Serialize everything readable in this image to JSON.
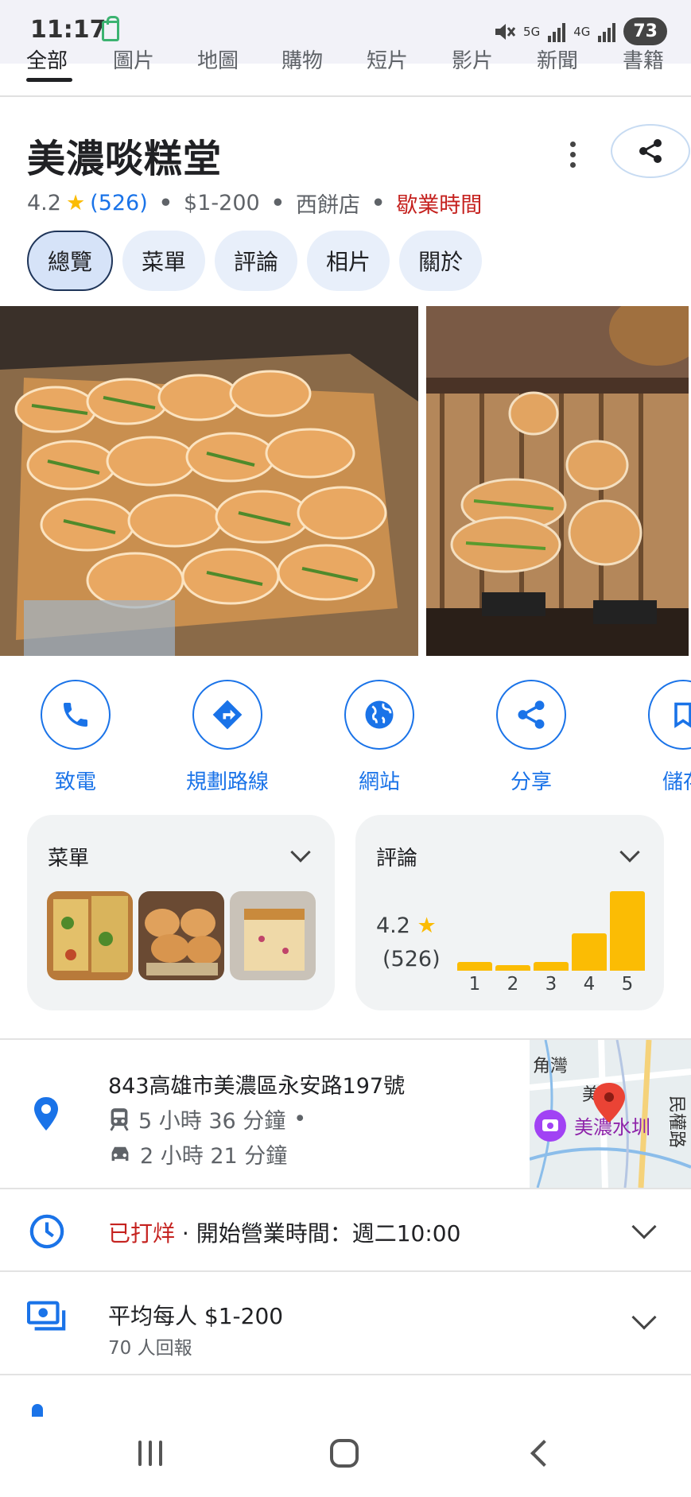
{
  "status_bar": {
    "time": "11:17",
    "network_5g": "5G",
    "network_4g": "4G",
    "battery": "73"
  },
  "search_tabs": [
    "全部",
    "圖片",
    "地圖",
    "購物",
    "短片",
    "影片",
    "新聞",
    "書籍"
  ],
  "place": {
    "name": "美濃啖糕堂",
    "rating": "4.2",
    "review_count": "(526)",
    "price": "$1-200",
    "category": "西餅店",
    "hours_status": "歇業時間"
  },
  "chips": [
    "總覽",
    "菜單",
    "評論",
    "相片",
    "關於"
  ],
  "actions": [
    {
      "label": "致電",
      "icon": "phone-icon"
    },
    {
      "label": "規劃路線",
      "icon": "directions-icon"
    },
    {
      "label": "網站",
      "icon": "globe-icon"
    },
    {
      "label": "分享",
      "icon": "share-icon"
    },
    {
      "label": "儲存",
      "icon": "bookmark-icon"
    }
  ],
  "menu_card": {
    "title": "菜單"
  },
  "reviews_card": {
    "title": "評論",
    "score": "4.2",
    "count": "(526)",
    "distribution_labels": [
      "1",
      "2",
      "3",
      "4",
      "5"
    ],
    "distribution_fraction": [
      0.08,
      0.05,
      0.08,
      0.34,
      0.72
    ]
  },
  "address": {
    "text": "843高雄市美濃區永安路197號",
    "transit": "5 小時 36 分鐘",
    "transit_sep": "•",
    "drive": "2 小時 21 分鐘"
  },
  "map": {
    "labels": [
      "角灣",
      "美濃",
      "美濃水圳",
      "民權路"
    ]
  },
  "hours": {
    "status": "已打烊",
    "detail": " · 開始營業時間：週二10:00"
  },
  "price_info": {
    "title": "平均每人 $1-200",
    "reports": "70 人回報"
  },
  "colors": {
    "accent": "#1a73e8",
    "star": "#fbbc04",
    "closed_red": "#c5221f"
  }
}
